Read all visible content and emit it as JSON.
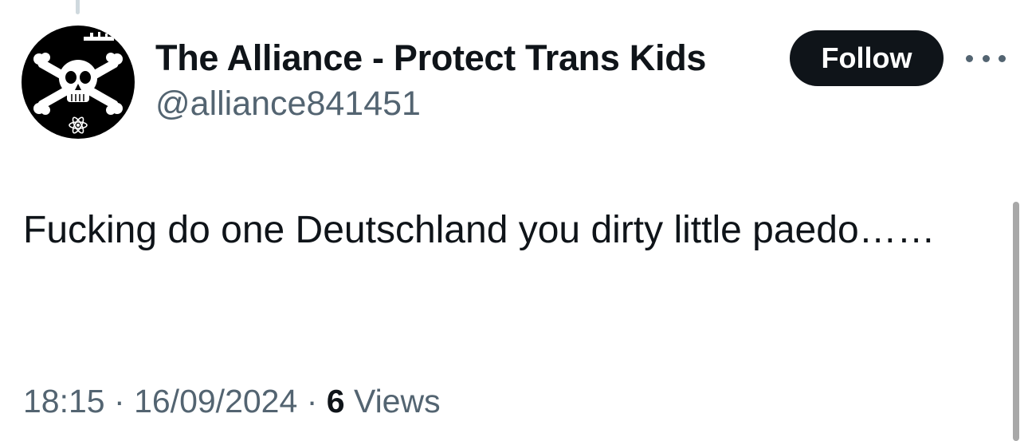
{
  "tweet": {
    "author": {
      "display_name": "The Alliance - Protect Trans Kids",
      "handle": "@alliance841451",
      "avatar_icon": "skull-crossbones-icon"
    },
    "follow_label": "Follow",
    "more_icon": "more-options-icon",
    "text": "Fucking do one Deutschland you dirty little paedo……",
    "meta": {
      "time": "18:15",
      "separator": "·",
      "date": "16/09/2024",
      "views_count": "6",
      "views_label": "Views"
    }
  },
  "colors": {
    "text_primary": "#0f1419",
    "text_secondary": "#536471",
    "button_bg": "#0f1419",
    "button_text": "#ffffff"
  }
}
